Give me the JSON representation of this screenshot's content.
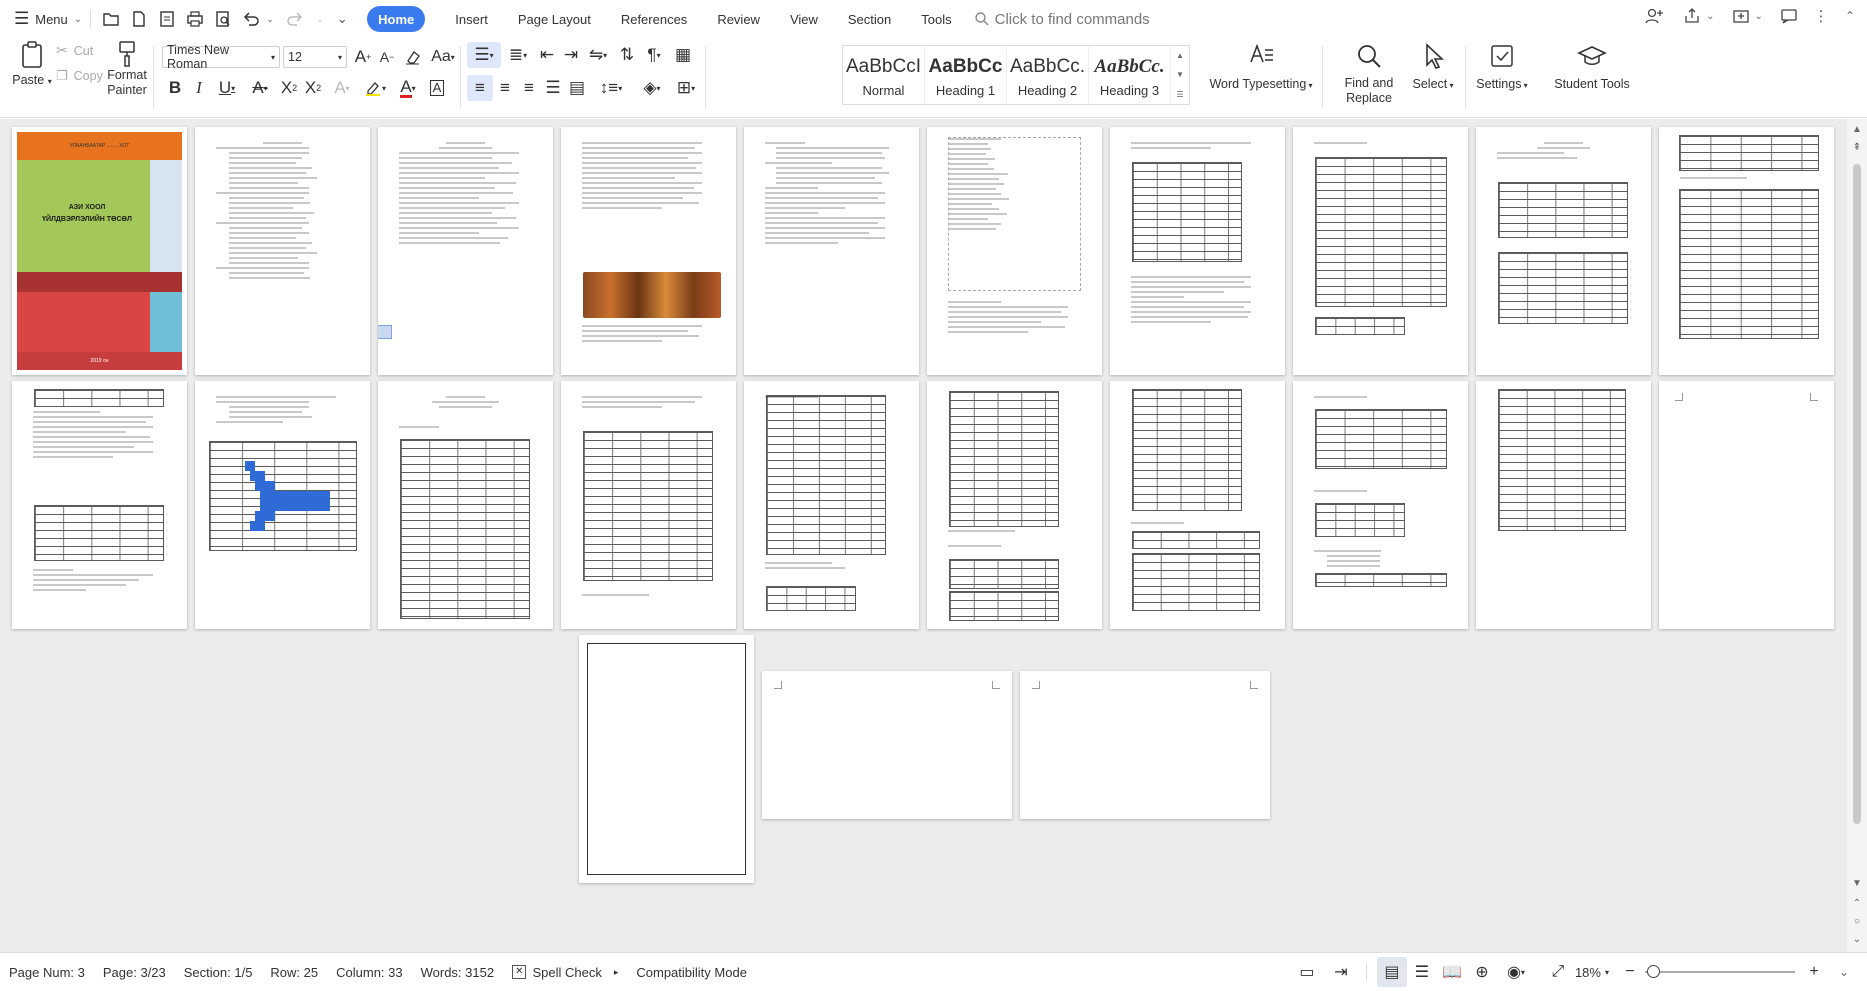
{
  "menubar": {
    "menu_label": "Menu",
    "tabs": [
      "Home",
      "Insert",
      "Page Layout",
      "References",
      "Review",
      "View",
      "Section",
      "Tools"
    ],
    "search_placeholder": "Click to find commands"
  },
  "ribbon": {
    "paste": "Paste",
    "cut": "Cut",
    "copy": "Copy",
    "format_painter_1": "Format",
    "format_painter_2": "Painter",
    "font_name": "Times New Roman",
    "font_size": "12",
    "styles": [
      {
        "sample": "AaBbCcI",
        "name": "Normal"
      },
      {
        "sample": "AaBbCc",
        "name": "Heading 1"
      },
      {
        "sample": "AaBbCc.",
        "name": "Heading 2"
      },
      {
        "sample": "AaBbCc.",
        "name": "Heading 3"
      }
    ],
    "word_typesetting": "Word Typesetting",
    "find_replace_1": "Find and",
    "find_replace_2": "Replace",
    "select": "Select",
    "settings": "Settings",
    "student_tools": "Student Tools"
  },
  "document": {
    "cover_title_1": "АЗИ ХООЛ",
    "cover_title_2": "ҮЙЛДВЭРЛЭЛИЙН ТӨСӨЛ",
    "cover_top": "УЛААНБААТАР ........ ХОТ",
    "cover_year": "2019 он"
  },
  "statusbar": {
    "page_num": "Page Num: 3",
    "page": "Page: 3/23",
    "section": "Section: 1/5",
    "row": "Row: 25",
    "column": "Column: 33",
    "words": "Words: 3152",
    "spell_check": "Spell Check",
    "compat": "Compatibility Mode",
    "zoom": "18%"
  }
}
